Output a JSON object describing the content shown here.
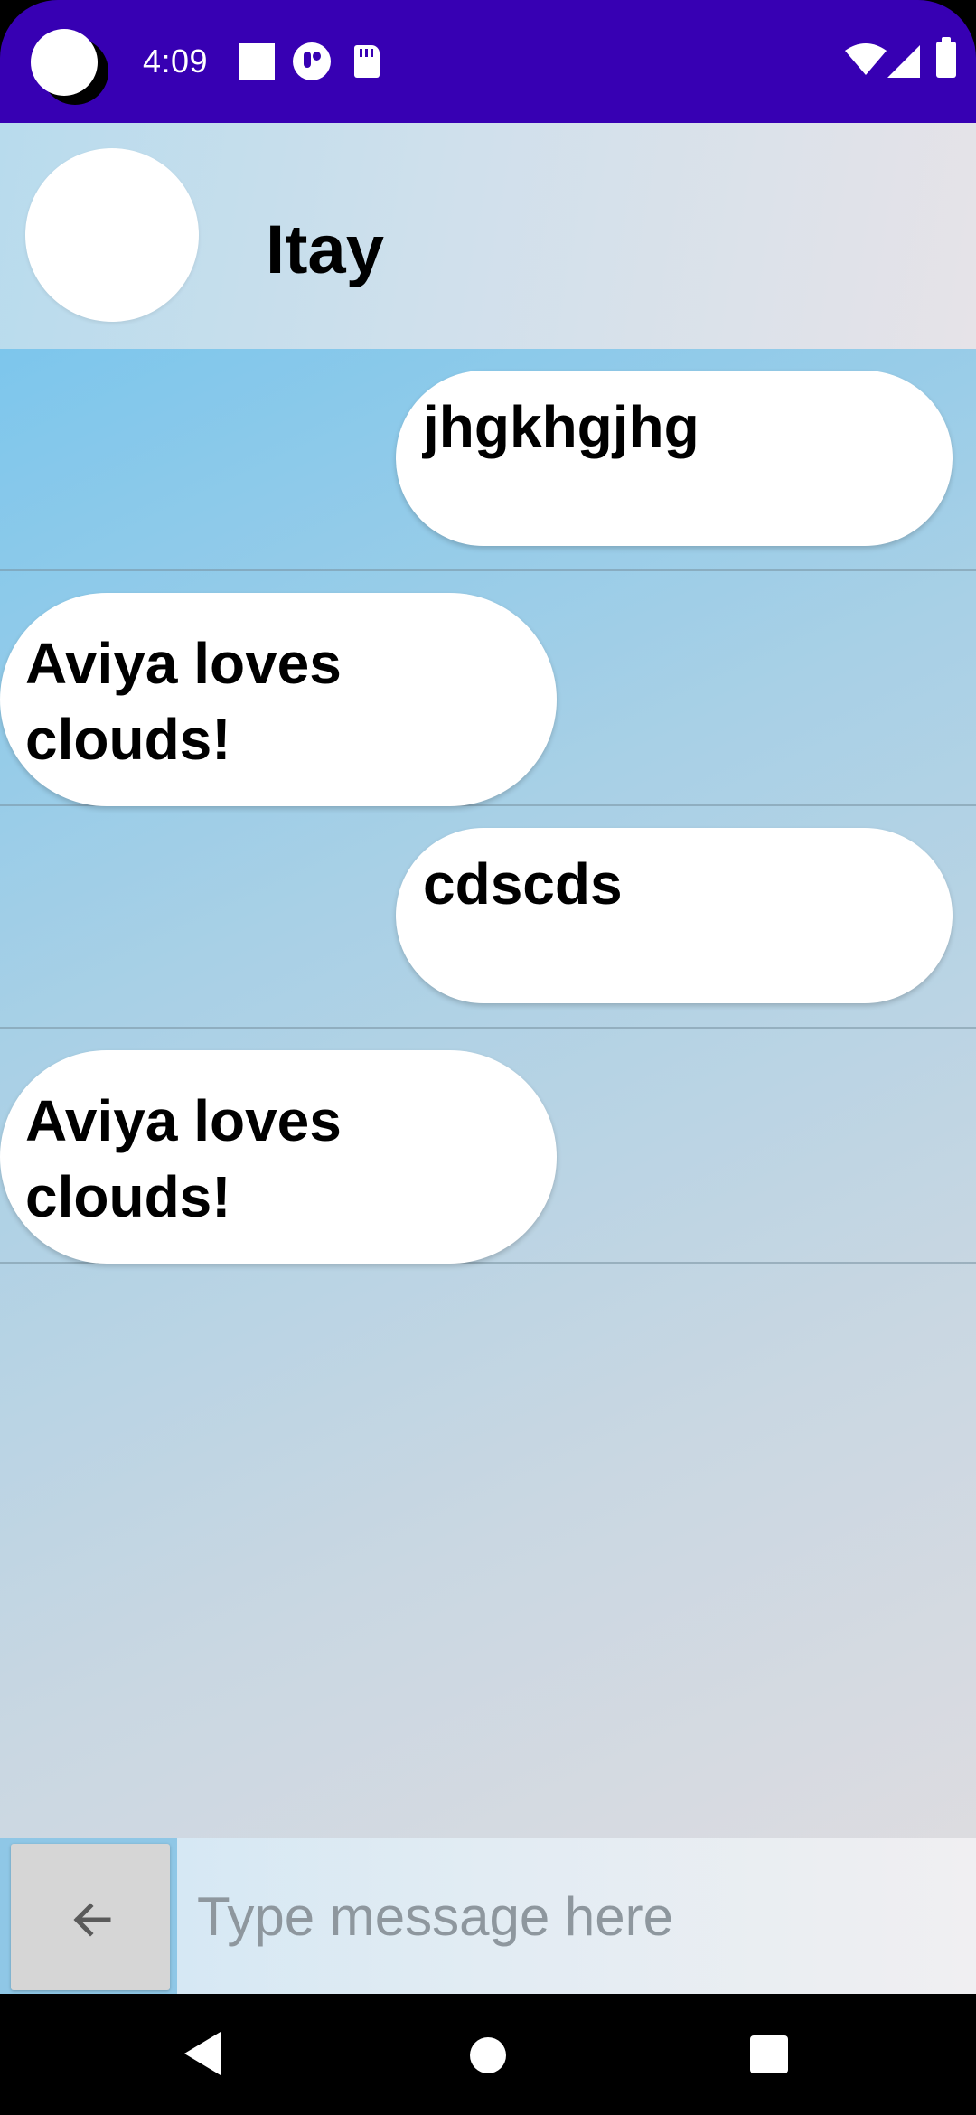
{
  "status_bar": {
    "time": "4:09",
    "bg_color": "#3700b3",
    "icons": [
      "camera-cutout-icon",
      "square-notification-icon",
      "circle-notification-icon",
      "sd-card-icon",
      "wifi-icon",
      "cell-signal-icon",
      "battery-icon"
    ]
  },
  "header": {
    "contact_name": "Itay"
  },
  "messages": [
    {
      "direction": "sent",
      "text": "jhgkhgjhg"
    },
    {
      "direction": "received",
      "text": "Aviya loves clouds!"
    },
    {
      "direction": "sent",
      "text": "cdscds"
    },
    {
      "direction": "received",
      "text": "Aviya loves clouds!"
    }
  ],
  "input_bar": {
    "back_icon": "arrow-left-icon",
    "placeholder": "Type message here",
    "value": ""
  },
  "nav_bar": {
    "icons": [
      "nav-back-icon",
      "nav-home-icon",
      "nav-recents-icon"
    ]
  }
}
